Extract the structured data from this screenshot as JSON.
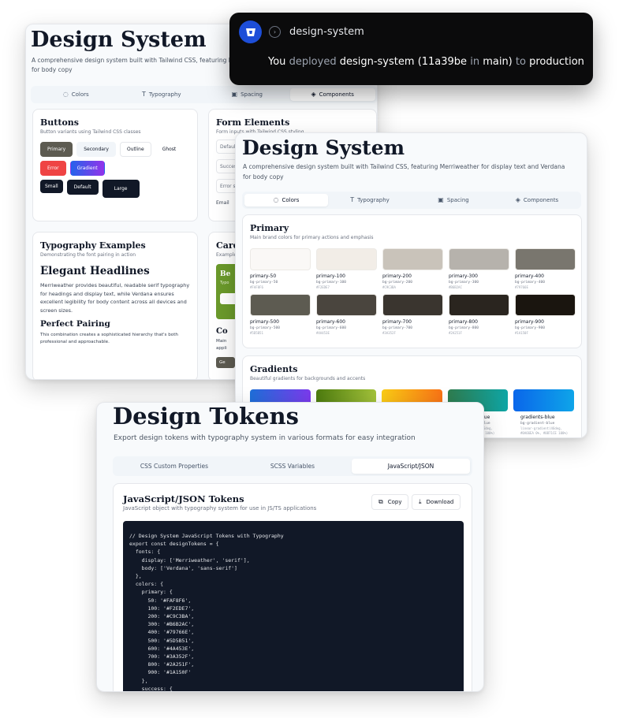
{
  "window1": {
    "title": "Design System",
    "subtitle_line1": "A comprehensive design system built with Tailwind CSS, featuring Merriweather for display text and Verdana",
    "subtitle_line2": "for body copy",
    "tabs": [
      "Colors",
      "Typography",
      "Spacing",
      "Components"
    ],
    "buttons_card": {
      "title": "Buttons",
      "subtitle": "Button variants using Tailwind CSS classes",
      "row1": [
        "Primary",
        "Secondary",
        "Outline",
        "Ghost"
      ],
      "row2": [
        "Error",
        "Gradient"
      ],
      "row3": [
        "Small",
        "Default",
        "Large"
      ]
    },
    "form_card": {
      "title": "Form Elements",
      "subtitle": "Form inputs with Tailwind CSS styling",
      "fields": [
        "Default",
        "Success",
        "Error s",
        "Email"
      ]
    },
    "typo_card": {
      "title": "Typography Examples",
      "subtitle": "Demonstrating the font pairing in action",
      "headline": "Elegant Headlines",
      "body1": "Merriweather provides beautiful, readable serif typography for headings and display text, while Verdana ensures excellent legibility for body content across all devices and screen sizes.",
      "headline2": "Perfect Pairing",
      "body2": "This combination creates a sophisticated hierarchy that's both professional and approachable."
    },
    "cards_card": {
      "title": "Cards",
      "subtitle": "Example",
      "feature_title": "Be",
      "feature_sub": "Typo",
      "content_title": "Co",
      "content_body": "Main appli",
      "button": "Ge"
    }
  },
  "notification": {
    "project": "design-system",
    "msg_you": "You",
    "msg_deployed": "deployed",
    "msg_project": "design-system",
    "msg_commit": "(11a39be",
    "msg_in": "in",
    "msg_branch": "main)",
    "msg_to": "to",
    "msg_env": "production"
  },
  "window2": {
    "title": "Design System",
    "subtitle_line1": "A comprehensive design system built with Tailwind CSS, featuring Merriweather for display text and Verdana",
    "subtitle_line2": "for body copy",
    "tabs": [
      "Colors",
      "Typography",
      "Spacing",
      "Components"
    ],
    "primary": {
      "title": "Primary",
      "subtitle": "Main brand colors for primary actions and emphasis",
      "swatches": [
        {
          "name": "primary-50",
          "cls": "bg-primary-50",
          "hex": "#FAF8F6",
          "color": "#FAF8F6"
        },
        {
          "name": "primary-100",
          "cls": "bg-primary-100",
          "hex": "#F2EDE7",
          "color": "#F2EDE7"
        },
        {
          "name": "primary-200",
          "cls": "bg-primary-200",
          "hex": "#C9C3BA",
          "color": "#C9C3BA"
        },
        {
          "name": "primary-300",
          "cls": "bg-primary-300",
          "hex": "#B6B2AC",
          "color": "#B6B2AC"
        },
        {
          "name": "primary-400",
          "cls": "bg-primary-400",
          "hex": "#79766E",
          "color": "#79766E"
        },
        {
          "name": "primary-500",
          "cls": "bg-primary-500",
          "hex": "#5D5B51",
          "color": "#5D5B51"
        },
        {
          "name": "primary-600",
          "cls": "bg-primary-600",
          "hex": "#4A453E",
          "color": "#4A453E"
        },
        {
          "name": "primary-700",
          "cls": "bg-primary-700",
          "hex": "#3A352F",
          "color": "#3A352F"
        },
        {
          "name": "primary-800",
          "cls": "bg-primary-800",
          "hex": "#2A251F",
          "color": "#2A251F"
        },
        {
          "name": "primary-900",
          "cls": "bg-primary-900",
          "hex": "#1A150F",
          "color": "#1A150F"
        }
      ]
    },
    "gradients": {
      "title": "Gradients",
      "subtitle": "Beautiful gradients for backgrounds and accents",
      "label_partial": "Blue",
      "label_partial_cls": "-blue",
      "label_partial_css": "(46deg,",
      "label_partial_hex": "8% 100%)",
      "label_full": "gradients-blue",
      "label_full_cls": "bg-gradient-blue",
      "label_full_css": "linear-gradient(46deg,",
      "label_full_hex": "#0A66EA 0%, #0B71CE 100%)"
    }
  },
  "window3": {
    "title": "Design Tokens",
    "subtitle": "Export design tokens with typography system in various formats for easy integration",
    "tabs": [
      "CSS Custom Properties",
      "SCSS Variables",
      "JavaScript/JSON"
    ],
    "panel_title": "JavaScript/JSON Tokens",
    "panel_subtitle": "JavaScript object with typography system for use in JS/TS applications",
    "copy_label": "Copy",
    "download_label": "Download",
    "code": "// Design System JavaScript Tokens with Typography\nexport const designTokens = {\n  fonts: {\n    display: ['Merriweather', 'serif'],\n    body: ['Verdana', 'sans-serif']\n  },\n  colors: {\n    primary: {\n      50: '#FAF8F6',\n      100: '#F2EDE7',\n      200: '#C9C3BA',\n      300: '#B6B2AC',\n      400: '#79766E',\n      500: '#5D5B51',\n      600: '#4A453E',\n      700: '#3A352F',\n      800: '#2A251F',\n      900: '#1A150F'\n    },\n    success: {"
  }
}
